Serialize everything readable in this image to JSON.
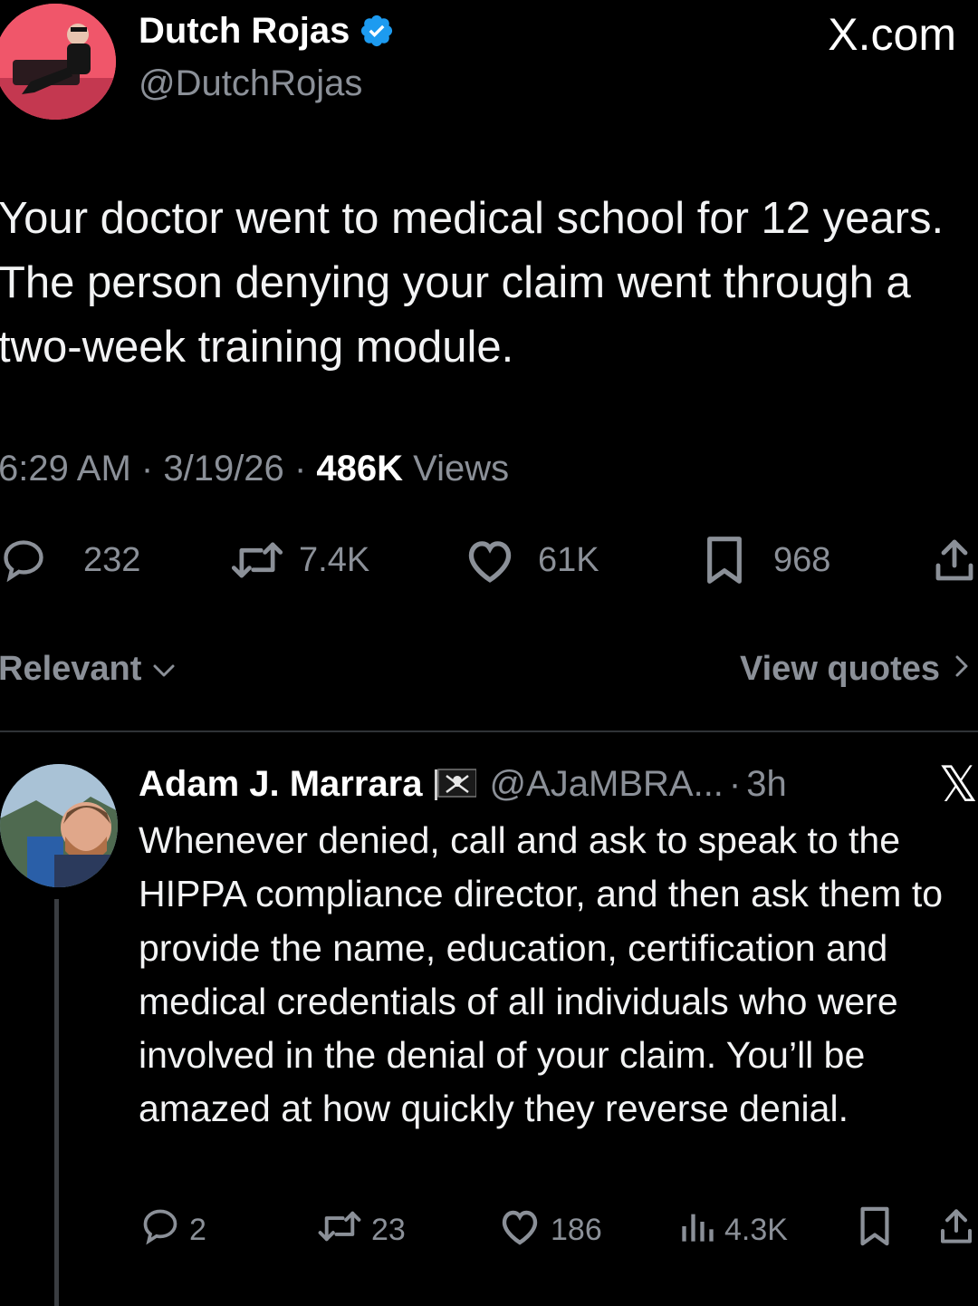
{
  "post": {
    "author_name": "Dutch Rojas",
    "author_handle": "@DutchRojas",
    "site_label": "X.com",
    "text": "Your doctor went to medical school for 12 years. The person denying your claim went through a two-week training module.",
    "time": "6:29 AM",
    "date": "3/19/26",
    "separator": "·",
    "views_count": "486K",
    "views_label": "Views",
    "actions": {
      "replies": "232",
      "reposts": "7.4K",
      "likes": "61K",
      "bookmarks": "968"
    }
  },
  "replies_bar": {
    "sort_label": "Relevant",
    "view_quotes_label": "View quotes"
  },
  "reply": {
    "author_name": "Adam J. Marrara",
    "author_handle": "@AJaMBRA...",
    "separator": "·",
    "time_ago": "3h",
    "x_mark": "𝕏",
    "text": "Whenever denied, call and ask to speak to the HIPPA compliance director, and then ask them to provide the name, education, certification and medical credentials of all individuals who were involved in the denial of your claim. You’ll be amazed at how quickly they reverse denial.",
    "actions": {
      "replies": "2",
      "reposts": "23",
      "likes": "186",
      "views": "4.3K"
    }
  },
  "colors": {
    "background": "#000000",
    "primary_text": "#e7e9ea",
    "secondary_text": "#8b9098",
    "verified_blue": "#1d9bf0",
    "divider": "#2f3336"
  },
  "icons": {
    "verified": "verified-badge-icon",
    "reply": "speech-bubble-icon",
    "repost": "repost-arrows-icon",
    "like": "heart-icon",
    "bookmark": "bookmark-icon",
    "share": "share-upload-icon",
    "views": "bar-chart-icon",
    "flag": "pirate-flag-icon"
  }
}
